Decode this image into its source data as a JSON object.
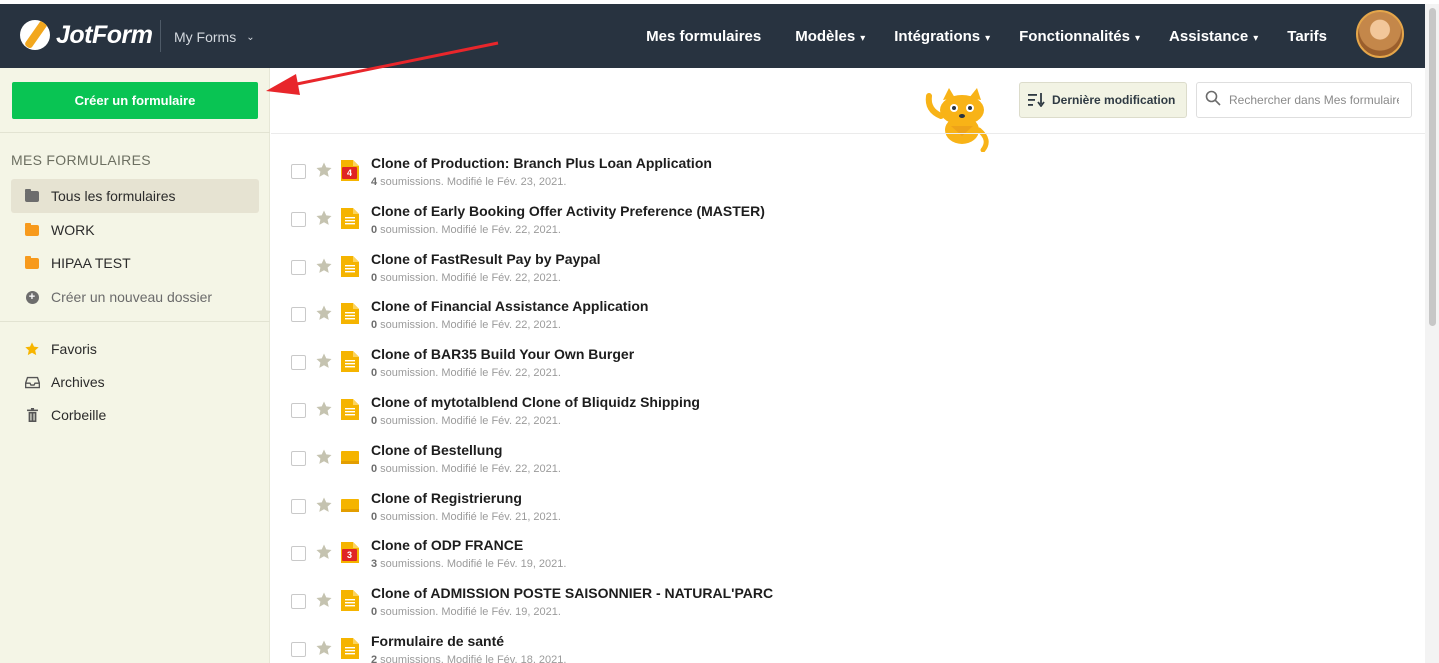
{
  "header": {
    "logo_text": "JotForm",
    "workspace": "My Forms",
    "nav": [
      {
        "label": "Mes formulaires",
        "caret": ""
      },
      {
        "label": "Modèles",
        "caret": "▾"
      },
      {
        "label": "Intégrations",
        "caret": "▾"
      },
      {
        "label": "Fonctionnalités",
        "caret": "▾"
      },
      {
        "label": "Assistance",
        "caret": "▾"
      },
      {
        "label": "Tarifs",
        "caret": ""
      }
    ]
  },
  "sidebar": {
    "create_label": "Créer un formulaire",
    "heading": "MES FORMULAIRES",
    "all_forms": "Tous les formulaires",
    "folders": [
      {
        "label": "WORK",
        "color": "#f79a1c"
      },
      {
        "label": "HIPAA TEST",
        "color": "#f79a1c"
      }
    ],
    "new_folder": "Créer un nouveau dossier",
    "favorites": "Favoris",
    "archives": "Archives",
    "trash": "Corbeille"
  },
  "toolbar": {
    "sort_label": "Dernière modification",
    "search_placeholder": "Rechercher dans Mes formulaires"
  },
  "forms": [
    {
      "title": "Clone of Production: Branch Plus Loan Application",
      "count": "4",
      "meta": " soumissions. Modifié le Fév. 23, 2021.",
      "badge": "4"
    },
    {
      "title": "Clone of Early Booking Offer Activity Preference (MASTER)",
      "count": "0",
      "meta": " soumission. Modifié le Fév. 22, 2021.",
      "badge": ""
    },
    {
      "title": "Clone of FastResult Pay by Paypal",
      "count": "0",
      "meta": " soumission. Modifié le Fév. 22, 2021.",
      "badge": ""
    },
    {
      "title": "Clone of Financial Assistance Application",
      "count": "0",
      "meta": " soumission. Modifié le Fév. 22, 2021.",
      "badge": ""
    },
    {
      "title": "Clone of BAR35 Build Your Own Burger",
      "count": "0",
      "meta": " soumission. Modifié le Fév. 22, 2021.",
      "badge": ""
    },
    {
      "title": "Clone of mytotalblend Clone of Bliquidz Shipping",
      "count": "0",
      "meta": " soumission. Modifié le Fév. 22, 2021.",
      "badge": ""
    },
    {
      "title": "Clone of Bestellung",
      "count": "0",
      "meta": " soumission. Modifié le Fév. 22, 2021.",
      "badge": ""
    },
    {
      "title": "Clone of Registrierung",
      "count": "0",
      "meta": " soumission. Modifié le Fév. 21, 2021.",
      "badge": ""
    },
    {
      "title": "Clone of ODP FRANCE",
      "count": "3",
      "meta": " soumissions. Modifié le Fév. 19, 2021.",
      "badge": "3"
    },
    {
      "title": "Clone of ADMISSION POSTE SAISONNIER - NATURAL'PARC",
      "count": "0",
      "meta": " soumission. Modifié le Fév. 19, 2021.",
      "badge": ""
    },
    {
      "title": "Formulaire de santé",
      "count": "2",
      "meta": " soumissions. Modifié le Fév. 18, 2021.",
      "badge": ""
    }
  ],
  "colors": {
    "header_bg": "#283340",
    "create_button": "#09c453",
    "sidebar_bg": "#f4f5e6",
    "form_icon": "#f5b400",
    "badge": "#e02424",
    "annotation_arrow": "#e8262b"
  }
}
